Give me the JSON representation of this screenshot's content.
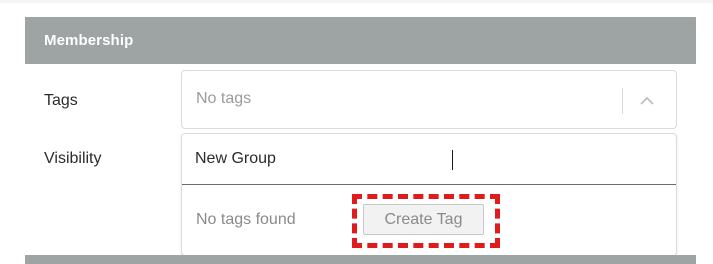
{
  "section": {
    "title": "Membership"
  },
  "fields": {
    "tags_label": "Tags",
    "visibility_label": "Visibility"
  },
  "tags_select": {
    "placeholder": "No tags",
    "toggle_icon": "chevron-up-icon"
  },
  "dropdown": {
    "search_value": "New Group",
    "empty_message": "No tags found",
    "create_button_label": "Create Tag"
  },
  "colors": {
    "header_bg": "#9ea4a4",
    "highlight": "#e01b1b"
  }
}
